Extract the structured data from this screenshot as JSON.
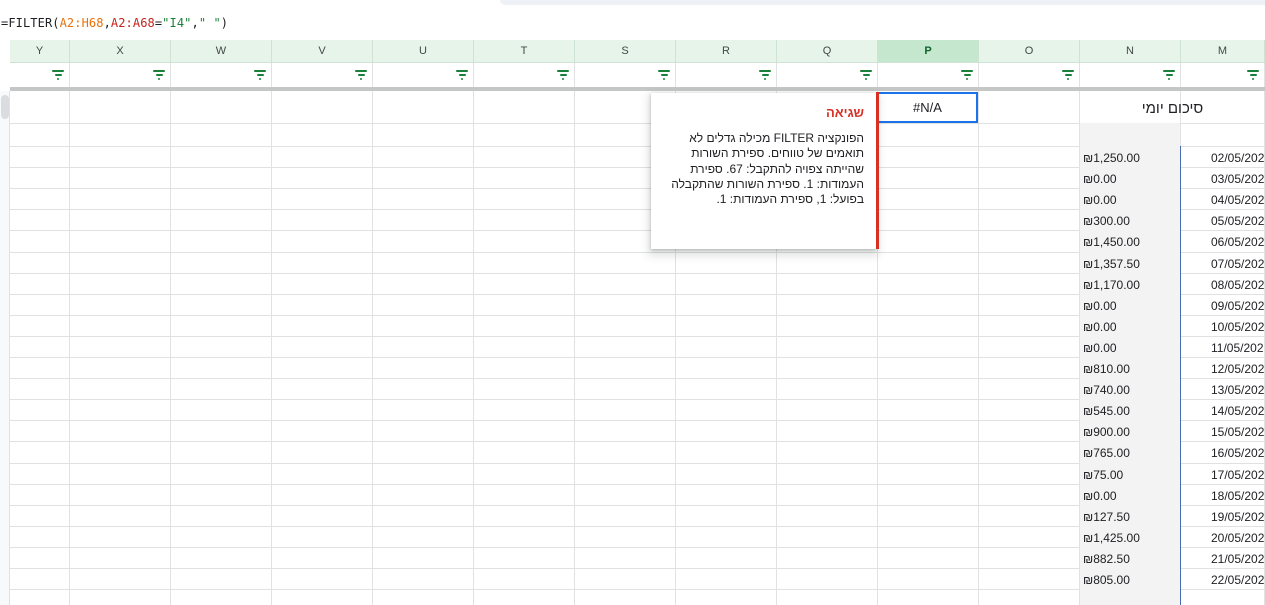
{
  "formula_bar": {
    "prefix": "=FILTER(",
    "range1": "A2:H68",
    "sep1": ",",
    "range2": "A2:A68",
    "eq": "=",
    "arg_str1": "\"I4\"",
    "sep2": ",",
    "arg_str2": "\" \"",
    "suffix": ")"
  },
  "columns": [
    "Y",
    "X",
    "W",
    "V",
    "U",
    "T",
    "S",
    "R",
    "Q",
    "P",
    "O",
    "N",
    "M"
  ],
  "selected_column": "P",
  "active_cell": {
    "value": "#N/A"
  },
  "daily_summary_header": "סיכום יומי",
  "error_popup": {
    "title": "שגיאה",
    "message": "הפונקציה FILTER מכילה גדלים לא תואמים של טווחים. ספירת השורות שהייתה צפויה להתקבל: 67. ספירת העמודות: 1. ספירת השורות שהתקבלה בפועל: 1, ספירת העמודות: 1."
  },
  "rows": [
    {
      "amount": "₪1,250.00",
      "date": "02/05/202"
    },
    {
      "amount": "₪0.00",
      "date": "03/05/202"
    },
    {
      "amount": "₪0.00",
      "date": "04/05/202"
    },
    {
      "amount": "₪300.00",
      "date": "05/05/202"
    },
    {
      "amount": "₪1,450.00",
      "date": "06/05/202"
    },
    {
      "amount": "₪1,357.50",
      "date": "07/05/202"
    },
    {
      "amount": "₪1,170.00",
      "date": "08/05/202"
    },
    {
      "amount": "₪0.00",
      "date": "09/05/202"
    },
    {
      "amount": "₪0.00",
      "date": "10/05/202"
    },
    {
      "amount": "₪0.00",
      "date": "11/05/202"
    },
    {
      "amount": "₪810.00",
      "date": "12/05/202"
    },
    {
      "amount": "₪740.00",
      "date": "13/05/202"
    },
    {
      "amount": "₪545.00",
      "date": "14/05/202"
    },
    {
      "amount": "₪900.00",
      "date": "15/05/202"
    },
    {
      "amount": "₪765.00",
      "date": "16/05/202"
    },
    {
      "amount": "₪75.00",
      "date": "17/05/202"
    },
    {
      "amount": "₪0.00",
      "date": "18/05/202"
    },
    {
      "amount": "₪127.50",
      "date": "19/05/202"
    },
    {
      "amount": "₪1,425.00",
      "date": "20/05/202"
    },
    {
      "amount": "₪882.50",
      "date": "21/05/202"
    },
    {
      "amount": "₪805.00",
      "date": "22/05/202"
    }
  ],
  "colors": {
    "header_bg": "#e6f4ea",
    "selected_header_bg": "#c4e7cd",
    "filter_icon": "#188038",
    "error_red": "#d93025",
    "active_border": "#1a73e8"
  }
}
